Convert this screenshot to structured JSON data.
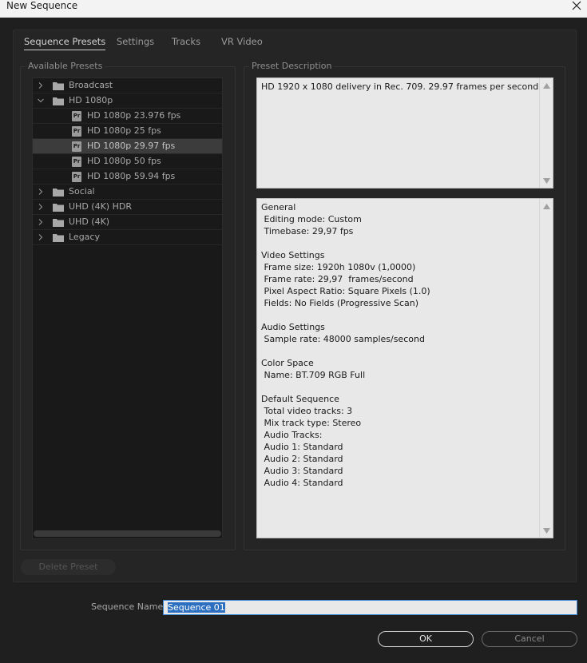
{
  "window": {
    "title": "New Sequence"
  },
  "tabs": [
    {
      "label": "Sequence Presets",
      "active": true
    },
    {
      "label": "Settings",
      "active": false
    },
    {
      "label": "Tracks",
      "active": false
    },
    {
      "label": "VR Video",
      "active": false
    }
  ],
  "presets": {
    "group_label": "Available Presets",
    "items": [
      {
        "label": "Broadcast",
        "type": "folder",
        "expanded": false
      },
      {
        "label": "HD 1080p",
        "type": "folder",
        "expanded": true
      },
      {
        "label": "HD 1080p 23.976 fps",
        "type": "preset"
      },
      {
        "label": "HD 1080p 25 fps",
        "type": "preset"
      },
      {
        "label": "HD 1080p 29.97 fps",
        "type": "preset",
        "selected": true
      },
      {
        "label": "HD 1080p 50 fps",
        "type": "preset"
      },
      {
        "label": "HD 1080p 59.94 fps",
        "type": "preset"
      },
      {
        "label": "Social",
        "type": "folder",
        "expanded": false
      },
      {
        "label": "UHD (4K) HDR",
        "type": "folder",
        "expanded": false
      },
      {
        "label": "UHD (4K)",
        "type": "folder",
        "expanded": false
      },
      {
        "label": "Legacy",
        "type": "folder",
        "expanded": false
      }
    ]
  },
  "description": {
    "group_label": "Preset Description",
    "summary": "HD 1920 x 1080 delivery in Rec. 709. 29.97 frames per second.",
    "details": "General\n Editing mode: Custom\n Timebase: 29,97 fps\n\nVideo Settings\n Frame size: 1920h 1080v (1,0000)\n Frame rate: 29,97  frames/second\n Pixel Aspect Ratio: Square Pixels (1.0)\n Fields: No Fields (Progressive Scan)\n\nAudio Settings\n Sample rate: 48000 samples/second\n\nColor Space\n Name: BT.709 RGB Full\n\nDefault Sequence\n Total video tracks: 3\n Mix track type: Stereo\n Audio Tracks:\n Audio 1: Standard\n Audio 2: Standard\n Audio 3: Standard\n Audio 4: Standard"
  },
  "buttons": {
    "delete_preset": "Delete Preset",
    "ok": "OK",
    "cancel": "Cancel"
  },
  "sequence_name": {
    "label": "Sequence Name:",
    "value": "Sequence 01"
  },
  "colors": {
    "background": "#1f1f1f",
    "selected_row": "#3c3c3c",
    "input_focus": "#3a86d8"
  }
}
